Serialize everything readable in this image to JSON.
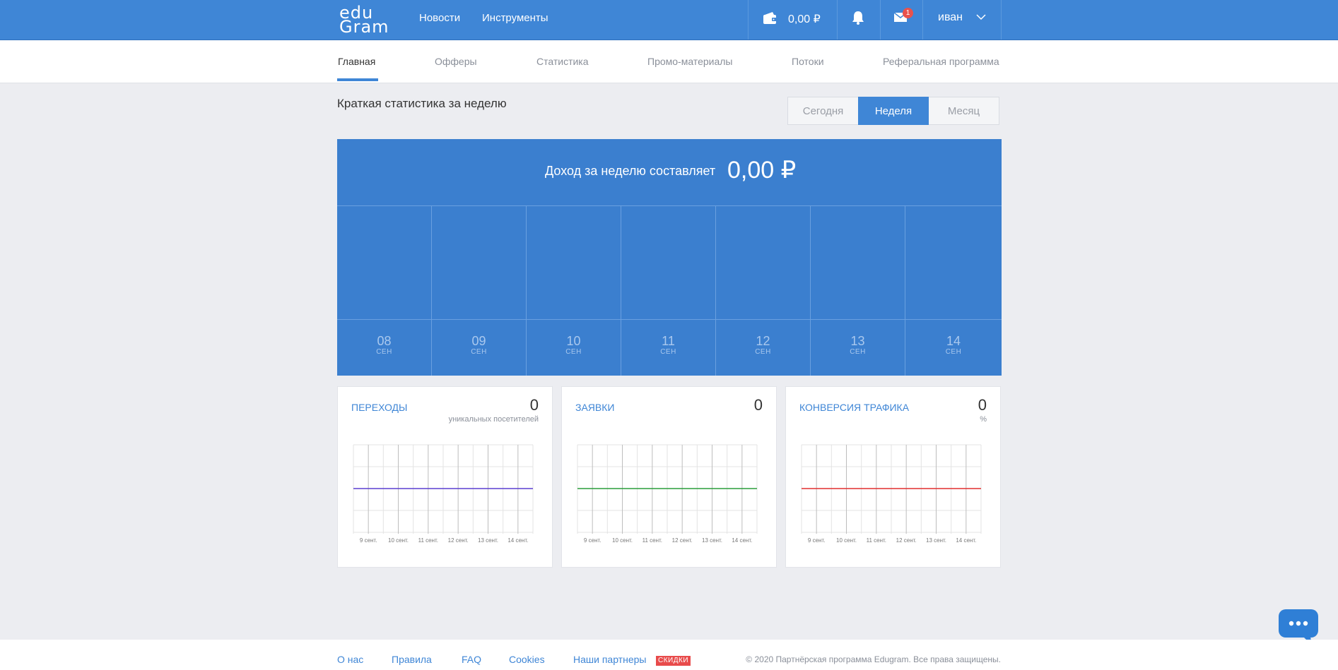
{
  "header": {
    "logo_line1": "edu",
    "logo_line2": "Gram",
    "nav": [
      "Новости",
      "Инструменты"
    ],
    "balance": "0,00 ₽",
    "mail_badge": "1",
    "user": "иван"
  },
  "tabs": [
    "Главная",
    "Офферы",
    "Статистика",
    "Промо-материалы",
    "Потоки",
    "Реферальная программа"
  ],
  "active_tab": "Главная",
  "section_title": "Краткая статистика за неделю",
  "periods": [
    "Сегодня",
    "Неделя",
    "Месяц"
  ],
  "active_period": "Неделя",
  "income": {
    "label": "Доход за неделю составляет",
    "amount": "0,00 ₽",
    "days": [
      {
        "num": "08",
        "mon": "СЕН"
      },
      {
        "num": "09",
        "mon": "СЕН"
      },
      {
        "num": "10",
        "mon": "СЕН"
      },
      {
        "num": "11",
        "mon": "СЕН"
      },
      {
        "num": "12",
        "mon": "СЕН"
      },
      {
        "num": "13",
        "mon": "СЕН"
      },
      {
        "num": "14",
        "mon": "СЕН"
      }
    ]
  },
  "cards": [
    {
      "title": "Переходы",
      "value": "0",
      "sub": "уникальных посетителей"
    },
    {
      "title": "Заявки",
      "value": "0",
      "sub": ""
    },
    {
      "title": "Конверсия трафика",
      "value": "0",
      "sub": "%"
    }
  ],
  "chart_data": [
    {
      "type": "line",
      "categories": [
        "9 сент.",
        "10 сент.",
        "11 сент.",
        "12 сент.",
        "13 сент.",
        "14 сент."
      ],
      "series": [
        {
          "values": [
            0,
            0,
            0,
            0,
            0,
            0
          ],
          "color": "#5b3fd0"
        }
      ]
    },
    {
      "type": "line",
      "categories": [
        "9 сент.",
        "10 сент.",
        "11 сент.",
        "12 сент.",
        "13 сент.",
        "14 сент."
      ],
      "series": [
        {
          "values": [
            0,
            0,
            0,
            0,
            0,
            0
          ],
          "color": "#2a9d3a"
        }
      ]
    },
    {
      "type": "line",
      "categories": [
        "9 сент.",
        "10 сент.",
        "11 сент.",
        "12 сент.",
        "13 сент.",
        "14 сент."
      ],
      "series": [
        {
          "values": [
            0,
            0,
            0,
            0,
            0,
            0
          ],
          "color": "#e02e2e"
        }
      ]
    }
  ],
  "footer": {
    "links": [
      "О нас",
      "Правила",
      "FAQ",
      "Cookies",
      "Наши партнеры"
    ],
    "badge": "СКИДКИ",
    "copyright": "© 2020 Партнёрская программа Edugram. Все права защищены."
  },
  "colors": {
    "primary": "#3f86d6",
    "panel": "#3b7fcf",
    "badge": "#e84b4b"
  },
  "icons": [
    "wallet-icon",
    "bell-icon",
    "mail-icon",
    "chevron-down-icon",
    "chat-icon"
  ]
}
